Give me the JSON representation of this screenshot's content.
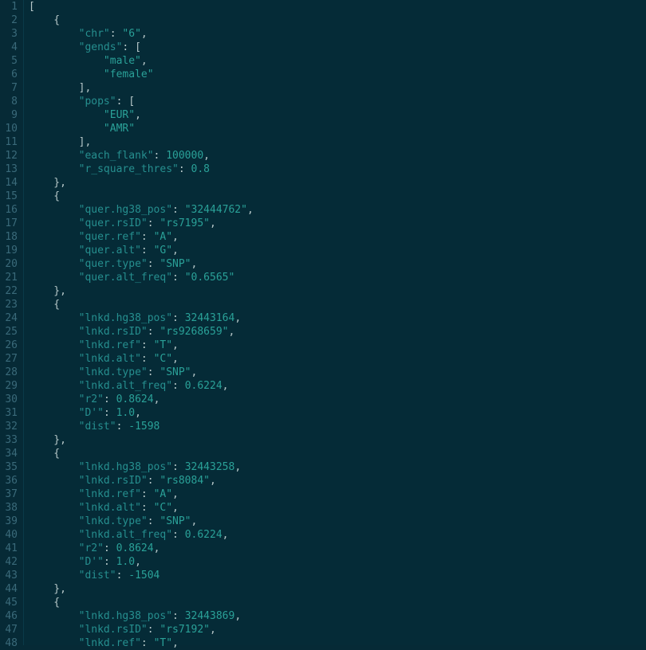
{
  "theme": {
    "background": "#062a36",
    "gutter_fg": "#3a6a7a",
    "key_color": "#268f8f",
    "value_color": "#2aa198",
    "punct_color": "#b6c7c8"
  },
  "first_line_number": 1,
  "lines": [
    {
      "n": 1,
      "tokens": [
        {
          "t": "p",
          "v": "["
        }
      ]
    },
    {
      "n": 2,
      "tokens": [
        {
          "t": "p",
          "v": "    {"
        }
      ]
    },
    {
      "n": 3,
      "tokens": [
        {
          "t": "p",
          "v": "        "
        },
        {
          "t": "k",
          "v": "\"chr\""
        },
        {
          "t": "p",
          "v": ": "
        },
        {
          "t": "s",
          "v": "\"6\""
        },
        {
          "t": "p",
          "v": ","
        }
      ]
    },
    {
      "n": 4,
      "tokens": [
        {
          "t": "p",
          "v": "        "
        },
        {
          "t": "k",
          "v": "\"gends\""
        },
        {
          "t": "p",
          "v": ": ["
        }
      ]
    },
    {
      "n": 5,
      "tokens": [
        {
          "t": "p",
          "v": "            "
        },
        {
          "t": "s",
          "v": "\"male\""
        },
        {
          "t": "p",
          "v": ","
        }
      ]
    },
    {
      "n": 6,
      "tokens": [
        {
          "t": "p",
          "v": "            "
        },
        {
          "t": "s",
          "v": "\"female\""
        }
      ]
    },
    {
      "n": 7,
      "tokens": [
        {
          "t": "p",
          "v": "        ],"
        }
      ]
    },
    {
      "n": 8,
      "tokens": [
        {
          "t": "p",
          "v": "        "
        },
        {
          "t": "k",
          "v": "\"pops\""
        },
        {
          "t": "p",
          "v": ": ["
        }
      ]
    },
    {
      "n": 9,
      "tokens": [
        {
          "t": "p",
          "v": "            "
        },
        {
          "t": "s",
          "v": "\"EUR\""
        },
        {
          "t": "p",
          "v": ","
        }
      ]
    },
    {
      "n": 10,
      "tokens": [
        {
          "t": "p",
          "v": "            "
        },
        {
          "t": "s",
          "v": "\"AMR\""
        }
      ]
    },
    {
      "n": 11,
      "tokens": [
        {
          "t": "p",
          "v": "        ],"
        }
      ]
    },
    {
      "n": 12,
      "tokens": [
        {
          "t": "p",
          "v": "        "
        },
        {
          "t": "k",
          "v": "\"each_flank\""
        },
        {
          "t": "p",
          "v": ": "
        },
        {
          "t": "n",
          "v": "100000"
        },
        {
          "t": "p",
          "v": ","
        }
      ]
    },
    {
      "n": 13,
      "tokens": [
        {
          "t": "p",
          "v": "        "
        },
        {
          "t": "k",
          "v": "\"r_square_thres\""
        },
        {
          "t": "p",
          "v": ": "
        },
        {
          "t": "n",
          "v": "0.8"
        }
      ]
    },
    {
      "n": 14,
      "tokens": [
        {
          "t": "p",
          "v": "    },"
        }
      ]
    },
    {
      "n": 15,
      "tokens": [
        {
          "t": "p",
          "v": "    {"
        }
      ]
    },
    {
      "n": 16,
      "tokens": [
        {
          "t": "p",
          "v": "        "
        },
        {
          "t": "k",
          "v": "\"quer.hg38_pos\""
        },
        {
          "t": "p",
          "v": ": "
        },
        {
          "t": "s",
          "v": "\"32444762\""
        },
        {
          "t": "p",
          "v": ","
        }
      ]
    },
    {
      "n": 17,
      "tokens": [
        {
          "t": "p",
          "v": "        "
        },
        {
          "t": "k",
          "v": "\"quer.rsID\""
        },
        {
          "t": "p",
          "v": ": "
        },
        {
          "t": "s",
          "v": "\"rs7195\""
        },
        {
          "t": "p",
          "v": ","
        }
      ]
    },
    {
      "n": 18,
      "tokens": [
        {
          "t": "p",
          "v": "        "
        },
        {
          "t": "k",
          "v": "\"quer.ref\""
        },
        {
          "t": "p",
          "v": ": "
        },
        {
          "t": "s",
          "v": "\"A\""
        },
        {
          "t": "p",
          "v": ","
        }
      ]
    },
    {
      "n": 19,
      "tokens": [
        {
          "t": "p",
          "v": "        "
        },
        {
          "t": "k",
          "v": "\"quer.alt\""
        },
        {
          "t": "p",
          "v": ": "
        },
        {
          "t": "s",
          "v": "\"G\""
        },
        {
          "t": "p",
          "v": ","
        }
      ]
    },
    {
      "n": 20,
      "tokens": [
        {
          "t": "p",
          "v": "        "
        },
        {
          "t": "k",
          "v": "\"quer.type\""
        },
        {
          "t": "p",
          "v": ": "
        },
        {
          "t": "s",
          "v": "\"SNP\""
        },
        {
          "t": "p",
          "v": ","
        }
      ]
    },
    {
      "n": 21,
      "tokens": [
        {
          "t": "p",
          "v": "        "
        },
        {
          "t": "k",
          "v": "\"quer.alt_freq\""
        },
        {
          "t": "p",
          "v": ": "
        },
        {
          "t": "s",
          "v": "\"0.6565\""
        }
      ]
    },
    {
      "n": 22,
      "tokens": [
        {
          "t": "p",
          "v": "    },"
        }
      ]
    },
    {
      "n": 23,
      "tokens": [
        {
          "t": "p",
          "v": "    {"
        }
      ]
    },
    {
      "n": 24,
      "tokens": [
        {
          "t": "p",
          "v": "        "
        },
        {
          "t": "k",
          "v": "\"lnkd.hg38_pos\""
        },
        {
          "t": "p",
          "v": ": "
        },
        {
          "t": "n",
          "v": "32443164"
        },
        {
          "t": "p",
          "v": ","
        }
      ]
    },
    {
      "n": 25,
      "tokens": [
        {
          "t": "p",
          "v": "        "
        },
        {
          "t": "k",
          "v": "\"lnkd.rsID\""
        },
        {
          "t": "p",
          "v": ": "
        },
        {
          "t": "s",
          "v": "\"rs9268659\""
        },
        {
          "t": "p",
          "v": ","
        }
      ]
    },
    {
      "n": 26,
      "tokens": [
        {
          "t": "p",
          "v": "        "
        },
        {
          "t": "k",
          "v": "\"lnkd.ref\""
        },
        {
          "t": "p",
          "v": ": "
        },
        {
          "t": "s",
          "v": "\"T\""
        },
        {
          "t": "p",
          "v": ","
        }
      ]
    },
    {
      "n": 27,
      "tokens": [
        {
          "t": "p",
          "v": "        "
        },
        {
          "t": "k",
          "v": "\"lnkd.alt\""
        },
        {
          "t": "p",
          "v": ": "
        },
        {
          "t": "s",
          "v": "\"C\""
        },
        {
          "t": "p",
          "v": ","
        }
      ]
    },
    {
      "n": 28,
      "tokens": [
        {
          "t": "p",
          "v": "        "
        },
        {
          "t": "k",
          "v": "\"lnkd.type\""
        },
        {
          "t": "p",
          "v": ": "
        },
        {
          "t": "s",
          "v": "\"SNP\""
        },
        {
          "t": "p",
          "v": ","
        }
      ]
    },
    {
      "n": 29,
      "tokens": [
        {
          "t": "p",
          "v": "        "
        },
        {
          "t": "k",
          "v": "\"lnkd.alt_freq\""
        },
        {
          "t": "p",
          "v": ": "
        },
        {
          "t": "n",
          "v": "0.6224"
        },
        {
          "t": "p",
          "v": ","
        }
      ]
    },
    {
      "n": 30,
      "tokens": [
        {
          "t": "p",
          "v": "        "
        },
        {
          "t": "k",
          "v": "\"r2\""
        },
        {
          "t": "p",
          "v": ": "
        },
        {
          "t": "n",
          "v": "0.8624"
        },
        {
          "t": "p",
          "v": ","
        }
      ]
    },
    {
      "n": 31,
      "tokens": [
        {
          "t": "p",
          "v": "        "
        },
        {
          "t": "k",
          "v": "\"D'\""
        },
        {
          "t": "p",
          "v": ": "
        },
        {
          "t": "n",
          "v": "1.0"
        },
        {
          "t": "p",
          "v": ","
        }
      ]
    },
    {
      "n": 32,
      "tokens": [
        {
          "t": "p",
          "v": "        "
        },
        {
          "t": "k",
          "v": "\"dist\""
        },
        {
          "t": "p",
          "v": ": "
        },
        {
          "t": "n",
          "v": "-1598"
        }
      ]
    },
    {
      "n": 33,
      "tokens": [
        {
          "t": "p",
          "v": "    },"
        }
      ]
    },
    {
      "n": 34,
      "tokens": [
        {
          "t": "p",
          "v": "    {"
        }
      ]
    },
    {
      "n": 35,
      "tokens": [
        {
          "t": "p",
          "v": "        "
        },
        {
          "t": "k",
          "v": "\"lnkd.hg38_pos\""
        },
        {
          "t": "p",
          "v": ": "
        },
        {
          "t": "n",
          "v": "32443258"
        },
        {
          "t": "p",
          "v": ","
        }
      ]
    },
    {
      "n": 36,
      "tokens": [
        {
          "t": "p",
          "v": "        "
        },
        {
          "t": "k",
          "v": "\"lnkd.rsID\""
        },
        {
          "t": "p",
          "v": ": "
        },
        {
          "t": "s",
          "v": "\"rs8084\""
        },
        {
          "t": "p",
          "v": ","
        }
      ]
    },
    {
      "n": 37,
      "tokens": [
        {
          "t": "p",
          "v": "        "
        },
        {
          "t": "k",
          "v": "\"lnkd.ref\""
        },
        {
          "t": "p",
          "v": ": "
        },
        {
          "t": "s",
          "v": "\"A\""
        },
        {
          "t": "p",
          "v": ","
        }
      ]
    },
    {
      "n": 38,
      "tokens": [
        {
          "t": "p",
          "v": "        "
        },
        {
          "t": "k",
          "v": "\"lnkd.alt\""
        },
        {
          "t": "p",
          "v": ": "
        },
        {
          "t": "s",
          "v": "\"C\""
        },
        {
          "t": "p",
          "v": ","
        }
      ]
    },
    {
      "n": 39,
      "tokens": [
        {
          "t": "p",
          "v": "        "
        },
        {
          "t": "k",
          "v": "\"lnkd.type\""
        },
        {
          "t": "p",
          "v": ": "
        },
        {
          "t": "s",
          "v": "\"SNP\""
        },
        {
          "t": "p",
          "v": ","
        }
      ]
    },
    {
      "n": 40,
      "tokens": [
        {
          "t": "p",
          "v": "        "
        },
        {
          "t": "k",
          "v": "\"lnkd.alt_freq\""
        },
        {
          "t": "p",
          "v": ": "
        },
        {
          "t": "n",
          "v": "0.6224"
        },
        {
          "t": "p",
          "v": ","
        }
      ]
    },
    {
      "n": 41,
      "tokens": [
        {
          "t": "p",
          "v": "        "
        },
        {
          "t": "k",
          "v": "\"r2\""
        },
        {
          "t": "p",
          "v": ": "
        },
        {
          "t": "n",
          "v": "0.8624"
        },
        {
          "t": "p",
          "v": ","
        }
      ]
    },
    {
      "n": 42,
      "tokens": [
        {
          "t": "p",
          "v": "        "
        },
        {
          "t": "k",
          "v": "\"D'\""
        },
        {
          "t": "p",
          "v": ": "
        },
        {
          "t": "n",
          "v": "1.0"
        },
        {
          "t": "p",
          "v": ","
        }
      ]
    },
    {
      "n": 43,
      "tokens": [
        {
          "t": "p",
          "v": "        "
        },
        {
          "t": "k",
          "v": "\"dist\""
        },
        {
          "t": "p",
          "v": ": "
        },
        {
          "t": "n",
          "v": "-1504"
        }
      ]
    },
    {
      "n": 44,
      "tokens": [
        {
          "t": "p",
          "v": "    },"
        }
      ]
    },
    {
      "n": 45,
      "tokens": [
        {
          "t": "p",
          "v": "    {"
        }
      ]
    },
    {
      "n": 46,
      "tokens": [
        {
          "t": "p",
          "v": "        "
        },
        {
          "t": "k",
          "v": "\"lnkd.hg38_pos\""
        },
        {
          "t": "p",
          "v": ": "
        },
        {
          "t": "n",
          "v": "32443869"
        },
        {
          "t": "p",
          "v": ","
        }
      ]
    },
    {
      "n": 47,
      "tokens": [
        {
          "t": "p",
          "v": "        "
        },
        {
          "t": "k",
          "v": "\"lnkd.rsID\""
        },
        {
          "t": "p",
          "v": ": "
        },
        {
          "t": "s",
          "v": "\"rs7192\""
        },
        {
          "t": "p",
          "v": ","
        }
      ]
    },
    {
      "n": 48,
      "tokens": [
        {
          "t": "p",
          "v": "        "
        },
        {
          "t": "k",
          "v": "\"lnkd.ref\""
        },
        {
          "t": "p",
          "v": ": "
        },
        {
          "t": "s",
          "v": "\"T\""
        },
        {
          "t": "p",
          "v": ","
        }
      ]
    }
  ]
}
